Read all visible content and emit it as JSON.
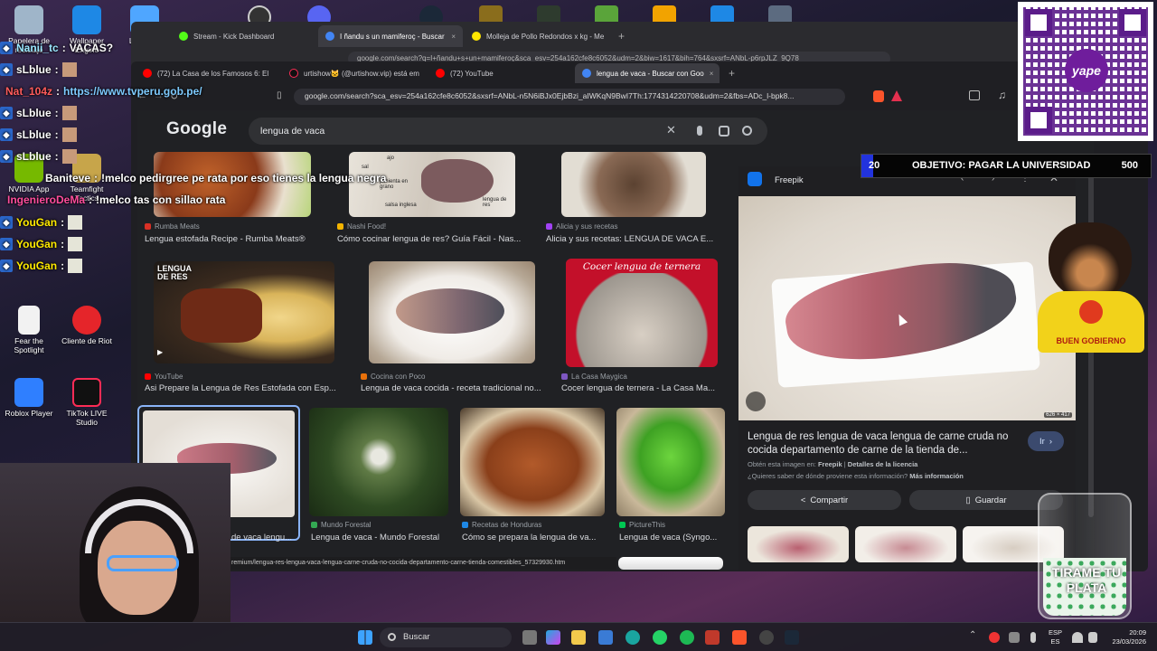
{
  "desktop": {
    "icons": [
      {
        "label": "Papelera de reciclaje",
        "color": "#9fb5c9"
      },
      {
        "label": "Wallpaper Engine",
        "color": "#1e88e5"
      },
      {
        "label": "LetsView",
        "color": "#4fa6ff"
      },
      {
        "label": "NVIDIA App",
        "color": "#76b900"
      },
      {
        "label": "Teamfight Tactics",
        "color": "#c7a54a"
      },
      {
        "label": "Fear the Spotlight",
        "color": "#ffffff"
      },
      {
        "label": "Cliente de Riot",
        "color": "#e5252a"
      },
      {
        "label": "Roblox Player",
        "color": "#2f7fff"
      },
      {
        "label": "TikTok LIVE Studio",
        "color": "#fe2c55"
      }
    ]
  },
  "browser_back": {
    "tabs": [
      {
        "label": "Stream - Kick Dashboard",
        "color": "#53fc18"
      },
      {
        "label": "I ñandu s un mamiferoç - Buscar",
        "color": "#4285f4",
        "active": true
      },
      {
        "label": "Molleja de Pollo Redondos x kg - Me",
        "color": "#ffe600"
      }
    ],
    "url": "google.com/search?q=I+ñandu+s+un+mamiferoç&sca_esv=254a162cfe8c6052&udm=2&biw=1617&bih=764&sxsrf=ANbL-p6rpJLZ_9Q78"
  },
  "browser_front": {
    "tabs": [
      {
        "label": "(72) La Casa de los Famosos 6: El",
        "color": "#ff0000"
      },
      {
        "label": "urtishow🐱 (@urtishow.vip) está em",
        "color": "#111111"
      },
      {
        "label": "(72) YouTube",
        "color": "#ff0000"
      },
      {
        "label": "lengua de vaca - Buscar con Goo",
        "color": "#4285f4",
        "active": true
      }
    ],
    "url": "google.com/search?sca_esv=254a162cfe8c6052&sxsrf=ANbL-n5N6iBJx0EjbBzi_aIWKqN9BwI7Th:1774314220708&udm=2&fbs=ADc_l-bpk8..."
  },
  "google": {
    "logo": "Google",
    "query": "lengua de vaca",
    "results": [
      {
        "source": "Rumba Meats",
        "title": "Lengua estofada Recipe - Rumba Meats®",
        "src_color": "#d93025"
      },
      {
        "source": "Nashi Food!",
        "title": "Cómo cocinar lengua de res? Guía Fácil - Nas...",
        "src_color": "#f4b400"
      },
      {
        "source": "Alicia y sus recetas",
        "title": "Alicia y sus recetas: LENGUA DE VACA E...",
        "src_color": "#a142f4"
      },
      {
        "source": "YouTube",
        "title": "Asi Prepare la Lengua de Res Estofada con Esp...",
        "src_color": "#ff0000"
      },
      {
        "source": "Cocina con Poco",
        "title": "Lengua de vaca cocida - receta tradicional no...",
        "src_color": "#e8710a"
      },
      {
        "source": "La Casa Maygica",
        "title": "Cocer lengua de ternera - La Casa Ma...",
        "src_color": "#7e57c2"
      },
      {
        "source": "",
        "title": "de vaca lengu...",
        "src_color": "#000000"
      },
      {
        "source": "Mundo Forestal",
        "title": "Lengua de vaca - Mundo Forestal",
        "src_color": "#34a853"
      },
      {
        "source": "Recetas de Honduras",
        "title": "Cómo se prepara la lengua de va...",
        "src_color": "#1e88e5"
      },
      {
        "source": "PictureThis",
        "title": "Lengua de vaca (Syngo...",
        "src_color": "#00c853"
      }
    ],
    "thumb_texts": {
      "lengua_de_res": "LENGUA DE RES",
      "cocer_lengua": "Cocer lengua de ternera",
      "sal": "sal",
      "ajo": "ajo",
      "pimienta": "pimienta en grano",
      "lengua_res_label": "lengua de res",
      "salsa": "salsa inglesa"
    },
    "status_url": "remium/lengua-res-lengua-vaca-lengua-carne-cruda-no-cocida-departamento-carne-tienda-comestibles_57329930.htm",
    "preview": {
      "source": "Freepik",
      "size": "626 × 417",
      "title": "Lengua de res lengua de vaca lengua de carne cruda no cocida departamento de carne de la tienda de...",
      "visit_label": "Ir",
      "license_prefix": "Obtén esta imagen en: ",
      "license_source": "Freepik",
      "license_sep": " | ",
      "license_link": "Detalles de la licencia",
      "question": "¿Quieres saber de dónde proviene esta información?",
      "more_info": "Más información",
      "share": "Compartir",
      "save": "Guardar"
    }
  },
  "overlay": {
    "chat": [
      {
        "user": "Nanii_tc",
        "msg": "VACAS?",
        "color": "#9be7ff"
      },
      {
        "user": "sLblue",
        "msg": "",
        "color": "#ffffff"
      },
      {
        "user": "Nat_104z",
        "msg": "https://www.tvperu.gob.pe/",
        "color": "#ff5c5c",
        "msg_color": "#7ecbff"
      },
      {
        "user": "sLblue",
        "msg": "",
        "color": "#ffffff"
      },
      {
        "user": "sLblue",
        "msg": "",
        "color": "#ffffff"
      },
      {
        "user": "sLblue",
        "msg": "",
        "color": "#ffffff"
      },
      {
        "user": "Baniteve",
        "msg": "!melco pedirgree pe rata por eso tienes la lengua negra",
        "color": "#ffffff"
      },
      {
        "user": "IngenieroDeMa",
        "msg": "!melco tas con sillao rata",
        "color": "#ff4d9d"
      },
      {
        "user": "YouGan",
        "msg": "",
        "color": "#ffea00"
      },
      {
        "user": "YouGan",
        "msg": "",
        "color": "#ffea00"
      },
      {
        "user": "YouGan",
        "msg": "",
        "color": "#ffea00"
      }
    ],
    "goal": {
      "current": "20",
      "label": "OBJETIVO: PAGAR LA UNIVERSIDAD",
      "target": "500",
      "progress": 0.04
    },
    "qr_label": "yape",
    "mascot_label": "BUEN GOBIERNO",
    "tip_label": "TIRAME TU PLATA"
  },
  "taskbar": {
    "search": "Buscar",
    "lang": "ESP",
    "lang2": "ES",
    "time": "20:09",
    "date": "23/03/2026"
  }
}
